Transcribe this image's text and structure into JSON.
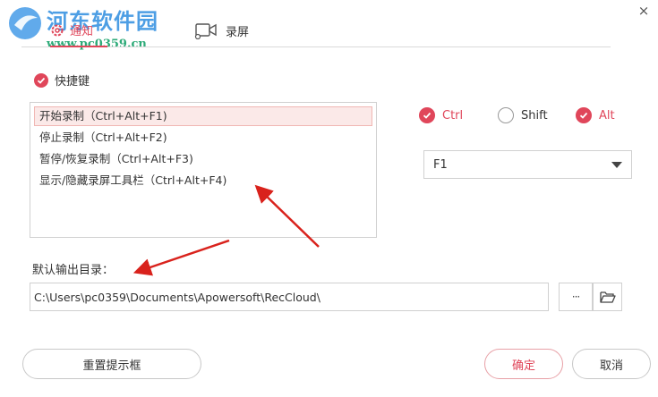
{
  "window": {
    "close_glyph": "×"
  },
  "watermark": {
    "title": "河东软件园",
    "url": "www.pc0359.cn"
  },
  "tabs": [
    {
      "label": "通知",
      "icon": "gear-icon",
      "active": true
    },
    {
      "label": "录屏",
      "icon": "camera-icon",
      "active": false
    }
  ],
  "hotkey": {
    "label": "快捷键",
    "checked": true
  },
  "shortcuts": [
    {
      "label": "开始录制（Ctrl+Alt+F1)",
      "selected": true
    },
    {
      "label": "停止录制（Ctrl+Alt+F2)",
      "selected": false
    },
    {
      "label": "暂停/恢复录制（Ctrl+Alt+F3)",
      "selected": false
    },
    {
      "label": "显示/隐藏录屏工具栏（Ctrl+Alt+F4)",
      "selected": false
    }
  ],
  "modifiers": [
    {
      "label": "Ctrl",
      "checked": true
    },
    {
      "label": "Shift",
      "checked": false
    },
    {
      "label": "Alt",
      "checked": true
    }
  ],
  "key_select": {
    "value": "F1"
  },
  "output": {
    "label": "默认输出目录：",
    "path": "C:\\Users\\pc0359\\Documents\\Apowersoft\\RecCloud\\",
    "more_label": "···"
  },
  "buttons": {
    "reset": "重置提示框",
    "ok": "确定",
    "cancel": "取消"
  },
  "colors": {
    "accent": "#e0465a",
    "annotation": "#d9221c"
  }
}
